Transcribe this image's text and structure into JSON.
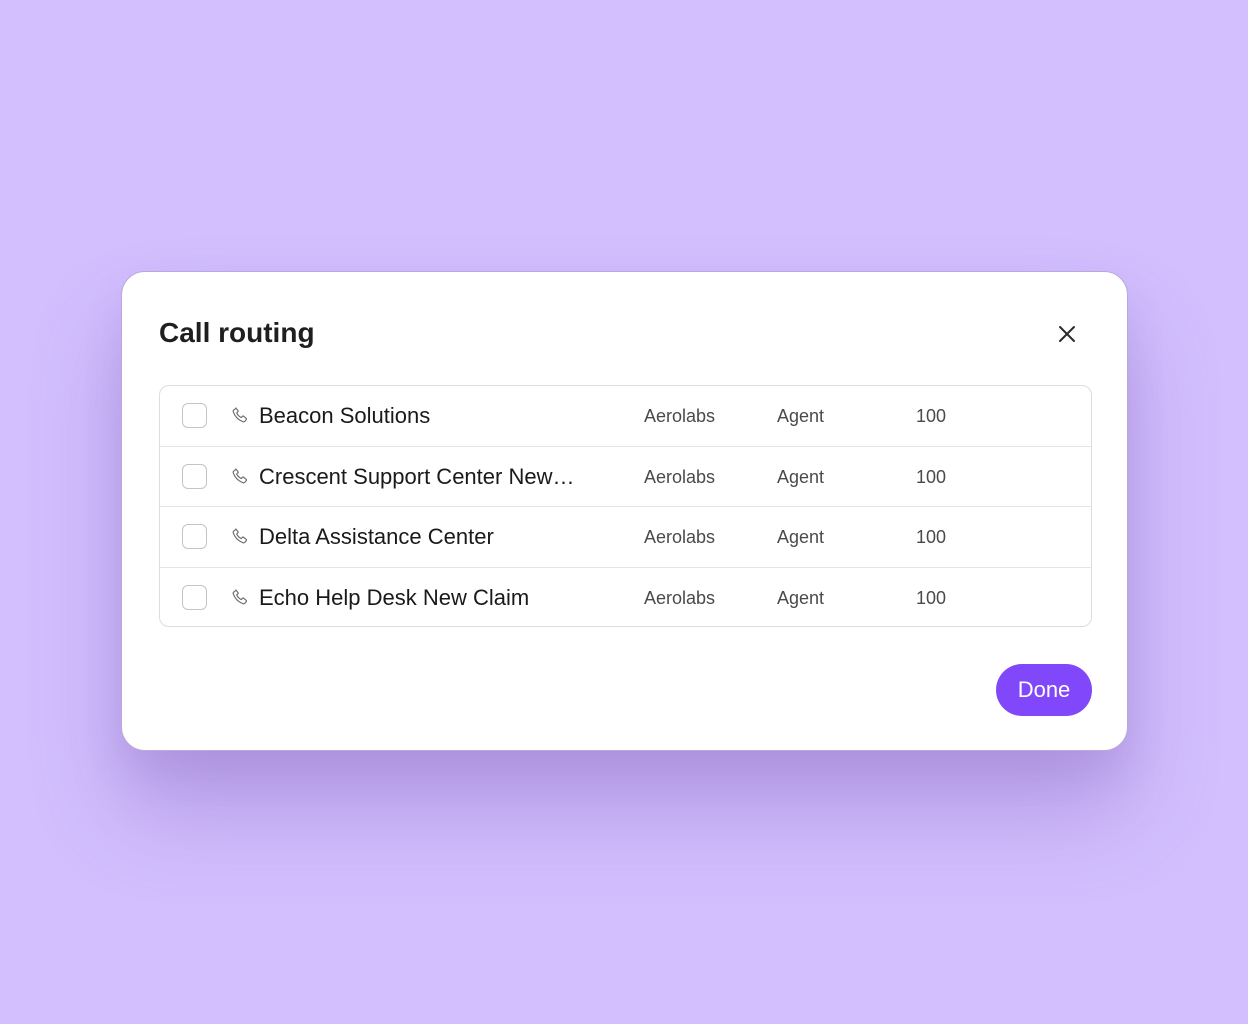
{
  "dialog": {
    "title": "Call routing",
    "close_icon": "close-icon",
    "done_label": "Done",
    "accent_color": "#8148fb",
    "background_color": "#d3bffe"
  },
  "rows": [
    {
      "name": "Beacon Solutions",
      "org": "Aerolabs",
      "role": "Agent",
      "number": "100",
      "checked": false,
      "icon": "phone-icon"
    },
    {
      "name": "Crescent Support Center New…",
      "org": "Aerolabs",
      "role": "Agent",
      "number": "100",
      "checked": false,
      "icon": "phone-icon"
    },
    {
      "name": "Delta Assistance Center",
      "org": "Aerolabs",
      "role": "Agent",
      "number": "100",
      "checked": false,
      "icon": "phone-icon"
    },
    {
      "name": "Echo Help Desk New Claim",
      "org": "Aerolabs",
      "role": "Agent",
      "number": "100",
      "checked": false,
      "icon": "phone-icon"
    }
  ]
}
